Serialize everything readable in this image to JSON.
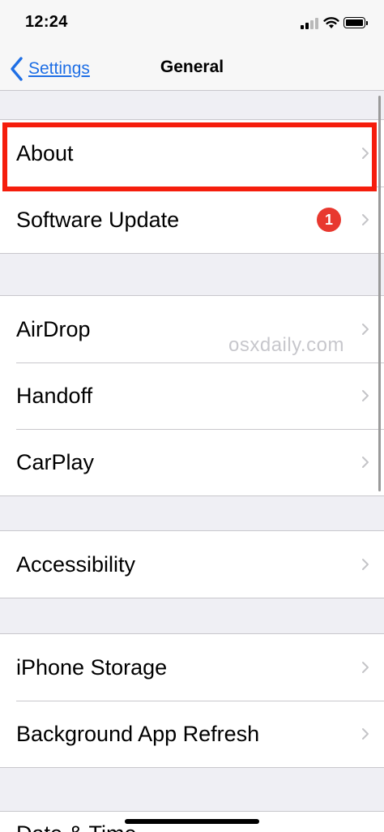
{
  "status_bar": {
    "time": "12:24",
    "icons": [
      "signal-icon",
      "wifi-icon",
      "battery-icon"
    ]
  },
  "nav": {
    "back_label": "Settings",
    "title": "General",
    "accent_color": "#1f6fe5"
  },
  "sections": [
    {
      "rows": [
        {
          "label": "About",
          "highlighted": true
        },
        {
          "label": "Software Update",
          "badge": "1"
        }
      ]
    },
    {
      "rows": [
        {
          "label": "AirDrop"
        },
        {
          "label": "Handoff"
        },
        {
          "label": "CarPlay"
        }
      ]
    },
    {
      "rows": [
        {
          "label": "Accessibility"
        }
      ]
    },
    {
      "rows": [
        {
          "label": "iPhone Storage"
        },
        {
          "label": "Background App Refresh"
        }
      ]
    }
  ],
  "partial_row": {
    "label": "Date & Time"
  },
  "watermark": "osxdaily.com",
  "highlight_color": "#f51d0c",
  "badge_color": "#e8382f"
}
